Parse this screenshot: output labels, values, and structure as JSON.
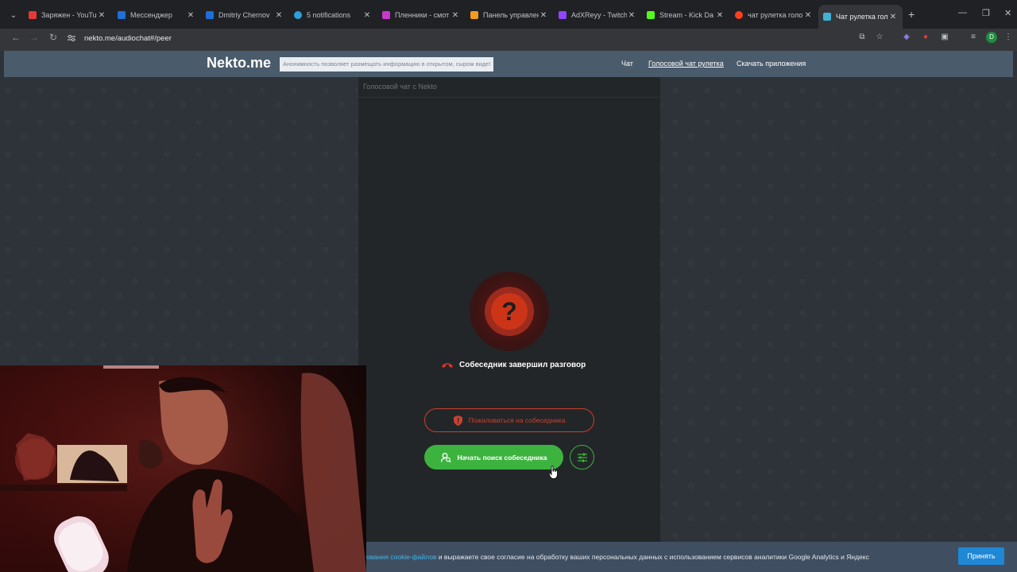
{
  "browser": {
    "tabs": [
      {
        "title": "Заряжен - YouTub",
        "color": "#e53935"
      },
      {
        "title": "Мессенджер",
        "color": "#1e6fd9"
      },
      {
        "title": "Dmitriy Chernov",
        "color": "#1e6fd9"
      },
      {
        "title": "5 notifications",
        "color": "#2aa1da"
      },
      {
        "title": "Пленники - смот",
        "color": "#c73acb"
      },
      {
        "title": "Панель управлен",
        "color": "#f29b1d"
      },
      {
        "title": "AdXReyy - Twitch",
        "color": "#9146ff"
      },
      {
        "title": "Stream - Kick Da",
        "color": "#53fc18"
      },
      {
        "title": "чат рулетка голо",
        "color": "#fc3f1d"
      },
      {
        "title": "Чат рулетка голо",
        "color": "#3fb3d6"
      }
    ],
    "url": "nekto.me/audiochat#/peer",
    "profile_initial": "D"
  },
  "site": {
    "logo": "Nekto.me",
    "tagline": "Анонимность позволяет размещать информацию в открытом, сыром виде!",
    "nav": {
      "chat": "Чат",
      "voice": "Голосовой чат рулетка",
      "apps": "Скачать приложения"
    }
  },
  "panel": {
    "title": "Голосовой чат с Nekto",
    "status_symbol": "?",
    "status_text": "Собеседник завершил разговор",
    "report_label": "Пожаловаться на собеседника",
    "search_label": "Начать поиск собеседника"
  },
  "cookie": {
    "link_text": "ования cookie-файлов",
    "text": " и выражаете свое согласие на обработку ваших персональных данных с использованием сервисов аналитики Google Analytics и Яндекс",
    "accept_label": "Принять"
  },
  "colors": {
    "accent_green": "#3cb33f",
    "danger_red": "#c9412e",
    "header_bg": "#4a5b6b"
  }
}
